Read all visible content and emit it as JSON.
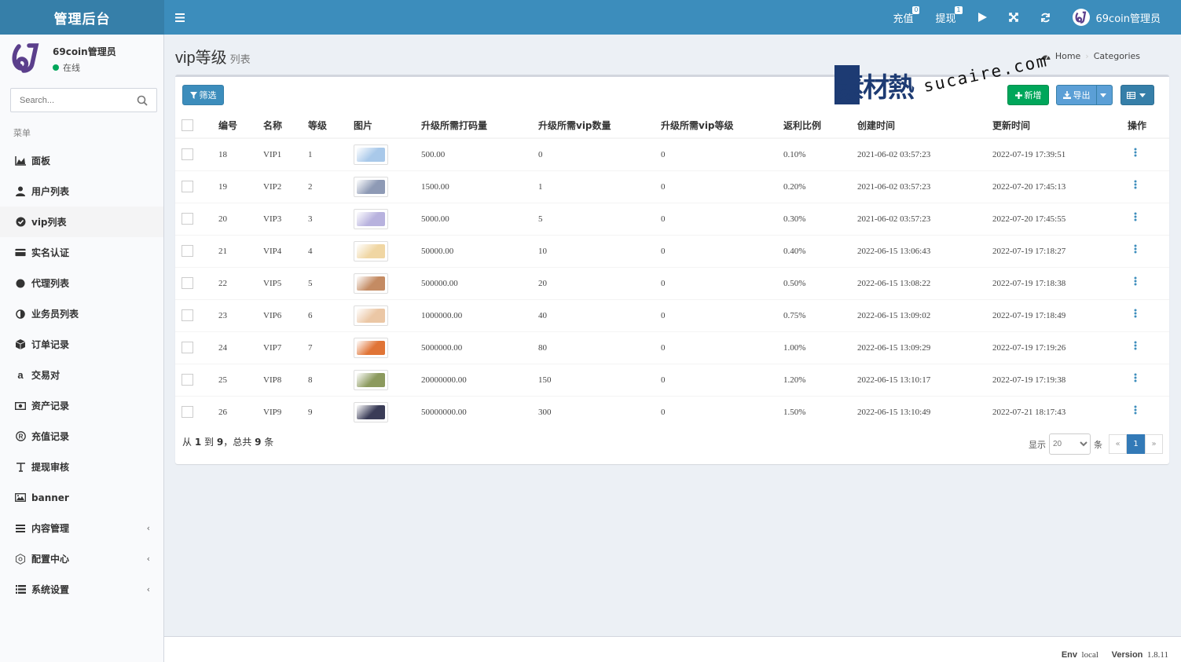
{
  "header": {
    "brand": "管理后台",
    "recharge_label": "充值",
    "recharge_badge": "0",
    "withdraw_label": "提现",
    "withdraw_badge": "1",
    "user_name": "69coin管理员"
  },
  "sidebar": {
    "user_name": "69coin管理员",
    "status": "在线",
    "search_placeholder": "Search...",
    "menu_header": "菜单",
    "items": [
      {
        "label": "面板",
        "icon": "area-chart-icon"
      },
      {
        "label": "用户列表",
        "icon": "user-icon"
      },
      {
        "label": "vip列表",
        "icon": "check-circle-icon"
      },
      {
        "label": "实名认证",
        "icon": "credit-card-icon"
      },
      {
        "label": "代理列表",
        "icon": "circle-icon"
      },
      {
        "label": "业务员列表",
        "icon": "half-circle-icon"
      },
      {
        "label": "订单记录",
        "icon": "cube-icon"
      },
      {
        "label": "交易对",
        "icon": "amazon-icon"
      },
      {
        "label": "资产记录",
        "icon": "money-icon"
      },
      {
        "label": "充值记录",
        "icon": "registered-icon"
      },
      {
        "label": "提现审核",
        "icon": "text-height-icon"
      },
      {
        "label": "banner",
        "icon": "image-icon"
      },
      {
        "label": "内容管理",
        "icon": "bars-icon"
      },
      {
        "label": "配置中心",
        "icon": "settings-icon"
      },
      {
        "label": "系统设置",
        "icon": "list-icon"
      }
    ]
  },
  "page": {
    "title": "vip等级",
    "subtitle": "列表",
    "breadcrumb_home": "Home",
    "breadcrumb_current": "Categories"
  },
  "toolbar": {
    "filter_label": "筛选",
    "add_label": "新增",
    "export_label": "导出"
  },
  "table": {
    "headers": [
      "编号",
      "名称",
      "等级",
      "图片",
      "升级所需打码量",
      "升级所需vip数量",
      "升级所需vip等级",
      "返利比例",
      "创建时间",
      "更新时间",
      "操作"
    ],
    "rows": [
      {
        "id": "18",
        "name": "VIP1",
        "level": "1",
        "color": "#a9c9ea",
        "bet": "500.00",
        "vip_count": "0",
        "vip_level": "0",
        "rebate": "0.10%",
        "created": "2021-06-02 03:57:23",
        "updated": "2022-07-19 17:39:51"
      },
      {
        "id": "19",
        "name": "VIP2",
        "level": "2",
        "color": "#8e9ab5",
        "bet": "1500.00",
        "vip_count": "1",
        "vip_level": "0",
        "rebate": "0.20%",
        "created": "2021-06-02 03:57:23",
        "updated": "2022-07-20 17:45:13"
      },
      {
        "id": "20",
        "name": "VIP3",
        "level": "3",
        "color": "#b8b2de",
        "bet": "5000.00",
        "vip_count": "5",
        "vip_level": "0",
        "rebate": "0.30%",
        "created": "2021-06-02 03:57:23",
        "updated": "2022-07-20 17:45:55"
      },
      {
        "id": "21",
        "name": "VIP4",
        "level": "4",
        "color": "#f0d6a3",
        "bet": "50000.00",
        "vip_count": "10",
        "vip_level": "0",
        "rebate": "0.40%",
        "created": "2022-06-15 13:06:43",
        "updated": "2022-07-19 17:18:27"
      },
      {
        "id": "22",
        "name": "VIP5",
        "level": "5",
        "color": "#c48b63",
        "bet": "500000.00",
        "vip_count": "20",
        "vip_level": "0",
        "rebate": "0.50%",
        "created": "2022-06-15 13:08:22",
        "updated": "2022-07-19 17:18:38"
      },
      {
        "id": "23",
        "name": "VIP6",
        "level": "6",
        "color": "#ebc7a5",
        "bet": "1000000.00",
        "vip_count": "40",
        "vip_level": "0",
        "rebate": "0.75%",
        "created": "2022-06-15 13:09:02",
        "updated": "2022-07-19 17:18:49"
      },
      {
        "id": "24",
        "name": "VIP7",
        "level": "7",
        "color": "#e07436",
        "bet": "5000000.00",
        "vip_count": "80",
        "vip_level": "0",
        "rebate": "1.00%",
        "created": "2022-06-15 13:09:29",
        "updated": "2022-07-19 17:19:26"
      },
      {
        "id": "25",
        "name": "VIP8",
        "level": "8",
        "color": "#8c9a5e",
        "bet": "20000000.00",
        "vip_count": "150",
        "vip_level": "0",
        "rebate": "1.20%",
        "created": "2022-06-15 13:10:17",
        "updated": "2022-07-19 17:19:38"
      },
      {
        "id": "26",
        "name": "VIP9",
        "level": "9",
        "color": "#3a3c57",
        "bet": "50000000.00",
        "vip_count": "300",
        "vip_level": "0",
        "rebate": "1.50%",
        "created": "2022-06-15 13:10:49",
        "updated": "2022-07-21 18:17:43"
      }
    ]
  },
  "pagination": {
    "summary_from": "从",
    "summary_start": "1",
    "summary_to": "到",
    "summary_end": "9",
    "summary_total_prefix": "，总共",
    "summary_total": "9",
    "summary_unit": "条",
    "show_label": "显示",
    "per_page": "20",
    "per_page_unit": "条",
    "prev": "«",
    "current": "1",
    "next": "»"
  },
  "footer": {
    "env_label": "Env",
    "env_value": "local",
    "version_label": "Version",
    "version_value": "1.8.11"
  },
  "watermark": {
    "cn": "素材熱",
    "en": "sucaire.com"
  },
  "colors": {
    "navbar": "#3c8dbc",
    "logo_bg": "#367fa9",
    "success": "#00a65a"
  }
}
